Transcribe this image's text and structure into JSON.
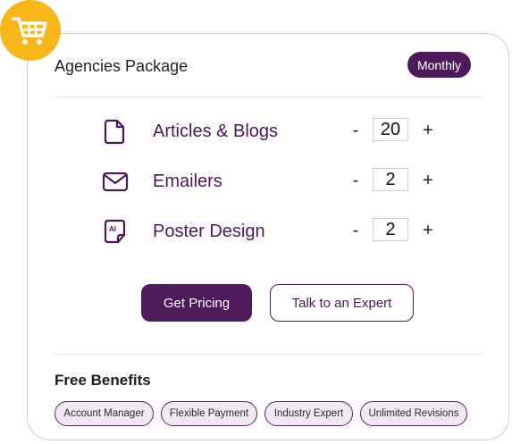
{
  "package": {
    "title": "Agencies Package",
    "billing_label": "Monthly"
  },
  "services": [
    {
      "name": "Articles & Blogs",
      "icon": "document-icon",
      "quantity": "20",
      "minus": "-",
      "plus": "+"
    },
    {
      "name": "Emailers",
      "icon": "envelope-icon",
      "quantity": "2",
      "minus": "-",
      "plus": "+"
    },
    {
      "name": "Poster Design",
      "icon": "ai-file-icon",
      "quantity": "2",
      "minus": "-",
      "plus": "+"
    }
  ],
  "actions": {
    "primary_label": "Get Pricing",
    "secondary_label": "Talk to an Expert"
  },
  "benefits": {
    "title": "Free Benefits",
    "items": [
      "Account Manager",
      "Flexible Payment",
      "Industry Expert",
      "Unlimited Revisions"
    ]
  },
  "colors": {
    "brand_purple": "#4d1a5a",
    "cart_badge": "#f7b61a",
    "chip_background": "#efe9f1"
  },
  "icons": {
    "cart": "shopping-cart-icon"
  }
}
